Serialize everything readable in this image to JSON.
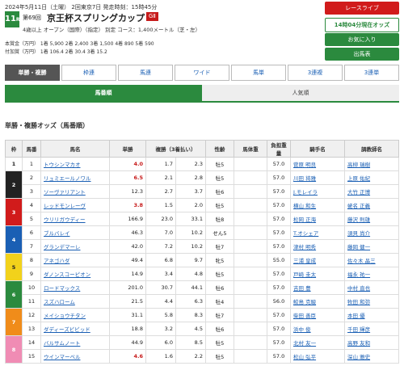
{
  "race": {
    "date_line": "2024年5月11日（土曜） 2回東京7日  発走時刻：15時45分",
    "number": "11",
    "number_unit": "R",
    "ordinal": "第69回",
    "name": "京王杯スプリングカップ",
    "grade": "GⅡ",
    "conditions": "4歳以上  オープン（国際）（指定）  別定   コース：1,400メートル（芝・左）",
    "prize_line1": "本賞金（万円）  1着  5,900   2着  2,400   3着  1,500   4着   890   5着   590",
    "prize_line2": "付加賞（万円）  1着  106.4   2着  30.4   3着  15.2"
  },
  "buttons": {
    "live": "レースライブ",
    "start": "14時04分現在オッズ",
    "favorite": "お気に入り",
    "bb": "出馬表"
  },
  "tabs": [
    "単勝・複勝",
    "枠連",
    "馬連",
    "ワイド",
    "馬単",
    "3連複",
    "3連単"
  ],
  "subtabs": [
    "馬番順",
    "人気順"
  ],
  "section_title": "単勝・複勝オッズ（馬番順）",
  "colors": {
    "frame1": "#ffffff",
    "frame2": "#222222",
    "frame3": "#d11b1b",
    "frame4": "#1a5fb4",
    "frame5": "#f2d21b",
    "frame6": "#2b8a3e",
    "frame7": "#f08c1a",
    "frame8": "#f08cb4"
  },
  "table": {
    "headers": [
      "枠",
      "馬番",
      "馬名",
      "単勝",
      "複勝（3着払い）",
      "",
      "性齢",
      "馬体重",
      "負担重量",
      "騎手名",
      "調教師名"
    ],
    "rows": [
      {
        "frame": "1",
        "num": "1",
        "name": "トウシンマカオ",
        "win": "4.0",
        "pmin": "1.7",
        "pmax": "2.3",
        "age": "牡5",
        "weight": "",
        "load": "57.0",
        "jockey": "菅原 明良",
        "trainer": "高柳 瑞樹",
        "red": true
      },
      {
        "frame": "2",
        "num": "2",
        "name": "リュミエールノワル",
        "win": "6.5",
        "pmin": "2.1",
        "pmax": "2.8",
        "age": "牡5",
        "weight": "",
        "load": "57.0",
        "jockey": "川田 将雅",
        "trainer": "上原 佑紀",
        "red": true
      },
      {
        "frame": "",
        "num": "3",
        "name": "ソーヴァリアント",
        "win": "12.3",
        "pmin": "2.7",
        "pmax": "3.7",
        "age": "牡6",
        "weight": "",
        "load": "57.0",
        "jockey": "J.モレイラ",
        "trainer": "大竹 正博",
        "red": false
      },
      {
        "frame": "3",
        "num": "4",
        "name": "レッドモンレーヴ",
        "win": "3.8",
        "pmin": "1.5",
        "pmax": "2.0",
        "age": "牡5",
        "weight": "",
        "load": "57.0",
        "jockey": "横山 和生",
        "trainer": "蛯名 正義",
        "red": true
      },
      {
        "frame": "",
        "num": "5",
        "name": "ウリリガウディー",
        "win": "166.9",
        "pmin": "23.0",
        "pmax": "33.1",
        "age": "牡8",
        "weight": "",
        "load": "57.0",
        "jockey": "松岡 正海",
        "trainer": "藤沢 則雄",
        "red": false
      },
      {
        "frame": "4",
        "num": "6",
        "name": "ブルバレイ",
        "win": "46.3",
        "pmin": "7.0",
        "pmax": "10.2",
        "age": "せん5",
        "weight": "",
        "load": "57.0",
        "jockey": "T.オシェア",
        "trainer": "須貝 尚介",
        "red": false
      },
      {
        "frame": "",
        "num": "7",
        "name": "グランデマーレ",
        "win": "42.0",
        "pmin": "7.2",
        "pmax": "10.2",
        "age": "牡7",
        "weight": "",
        "load": "57.0",
        "jockey": "津村 明秀",
        "trainer": "藤岡 健一",
        "red": false
      },
      {
        "frame": "5",
        "num": "8",
        "name": "アネゴハダ",
        "win": "49.4",
        "pmin": "6.8",
        "pmax": "9.7",
        "age": "牝5",
        "weight": "",
        "load": "55.0",
        "jockey": "三浦 皇成",
        "trainer": "佐々木 晶三",
        "red": false
      },
      {
        "frame": "",
        "num": "9",
        "name": "ダノンスコーピオン",
        "win": "14.9",
        "pmin": "3.4",
        "pmax": "4.8",
        "age": "牡5",
        "weight": "",
        "load": "57.0",
        "jockey": "戸崎 圭太",
        "trainer": "福永 祐一",
        "red": false
      },
      {
        "frame": "6",
        "num": "10",
        "name": "ロードマックス",
        "win": "201.0",
        "pmin": "30.7",
        "pmax": "44.1",
        "age": "牡6",
        "weight": "",
        "load": "57.0",
        "jockey": "吉田 豊",
        "trainer": "中村 直也",
        "red": false
      },
      {
        "frame": "",
        "num": "11",
        "name": "スズハローム",
        "win": "21.5",
        "pmin": "4.4",
        "pmax": "6.3",
        "age": "牡4",
        "weight": "",
        "load": "56.0",
        "jockey": "鮫島 克駿",
        "trainer": "牧田 和弥",
        "red": false
      },
      {
        "frame": "7",
        "num": "12",
        "name": "メイショウチタン",
        "win": "31.1",
        "pmin": "5.8",
        "pmax": "8.3",
        "age": "牡7",
        "weight": "",
        "load": "57.0",
        "jockey": "柴田 善臣",
        "trainer": "本田 優",
        "red": false
      },
      {
        "frame": "",
        "num": "13",
        "name": "ダディーズビビッド",
        "win": "18.8",
        "pmin": "3.2",
        "pmax": "4.5",
        "age": "牡6",
        "weight": "",
        "load": "57.0",
        "jockey": "浜中 俊",
        "trainer": "千田 輝彦",
        "red": false
      },
      {
        "frame": "8",
        "num": "14",
        "name": "バルサムノート",
        "win": "44.9",
        "pmin": "6.0",
        "pmax": "8.5",
        "age": "牡5",
        "weight": "",
        "load": "57.0",
        "jockey": "北村 友一",
        "trainer": "高野 友和",
        "red": false
      },
      {
        "frame": "",
        "num": "15",
        "name": "ウインマーベル",
        "win": "4.6",
        "pmin": "1.6",
        "pmax": "2.2",
        "age": "牡5",
        "weight": "",
        "load": "57.0",
        "jockey": "松山 弘平",
        "trainer": "深山 雅史",
        "red": true
      }
    ]
  }
}
